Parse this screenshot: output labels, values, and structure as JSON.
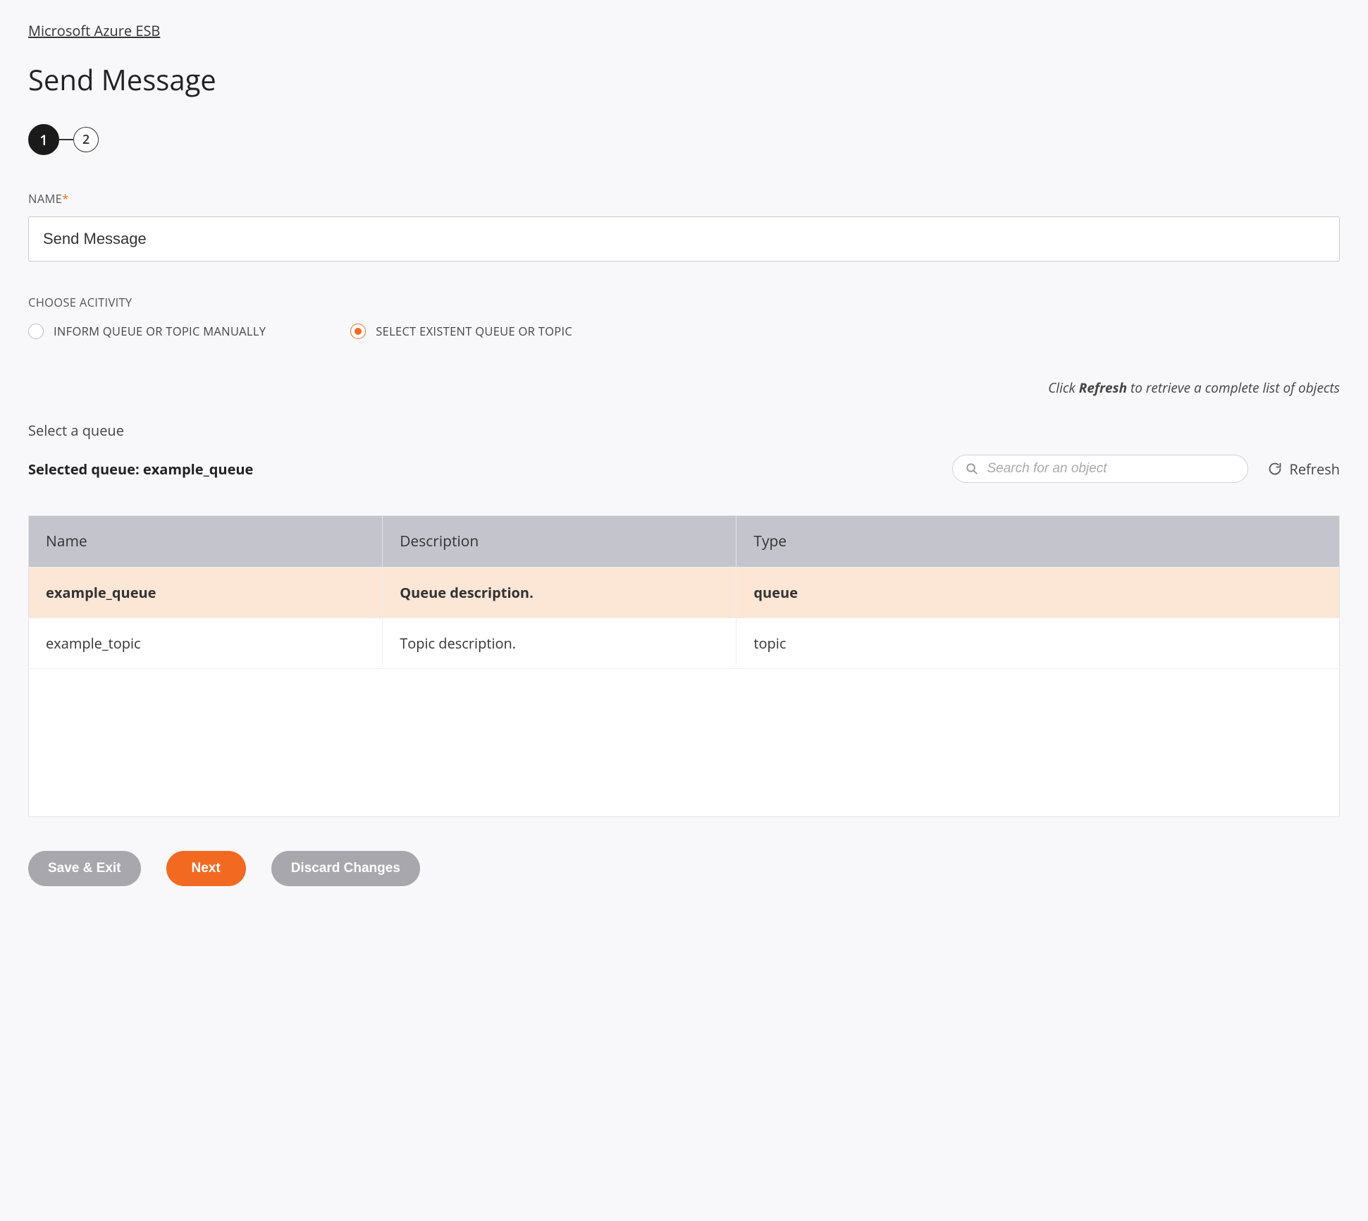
{
  "breadcrumb": {
    "label": "Microsoft Azure ESB"
  },
  "page": {
    "title": "Send Message"
  },
  "stepper": {
    "current": "1",
    "next": "2"
  },
  "nameField": {
    "label": "NAME",
    "required": "*",
    "value": "Send Message"
  },
  "activity": {
    "label": "CHOOSE ACITIVITY",
    "optionA": "INFORM QUEUE OR TOPIC MANUALLY",
    "optionB": "SELECT EXISTENT QUEUE OR TOPIC"
  },
  "hint": {
    "prefix": "Click ",
    "bold": "Refresh",
    "suffix": " to retrieve a complete list of objects"
  },
  "queue": {
    "selectLabel": "Select a queue",
    "selectedPrefix": "Selected queue: ",
    "selectedName": "example_queue"
  },
  "search": {
    "placeholder": "Search for an object"
  },
  "refresh": {
    "label": "Refresh"
  },
  "table": {
    "headers": {
      "name": "Name",
      "description": "Description",
      "type": "Type"
    },
    "rows": [
      {
        "name": "example_queue",
        "description": "Queue description.",
        "type": "queue"
      },
      {
        "name": "example_topic",
        "description": "Topic description.",
        "type": "topic"
      }
    ]
  },
  "buttons": {
    "save": "Save & Exit",
    "next": "Next",
    "discard": "Discard Changes"
  }
}
